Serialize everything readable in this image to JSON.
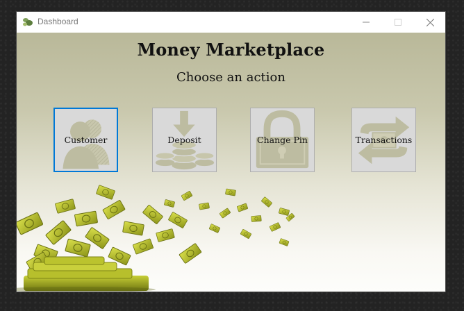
{
  "window": {
    "title": "Dashboard",
    "controls": {
      "minimize": "—",
      "maximize": "☐",
      "close": "✕"
    }
  },
  "main": {
    "heading": "Money Marketplace",
    "subheading": "Choose an action",
    "actions": [
      {
        "label": "Customer",
        "icon": "customer-icon"
      },
      {
        "label": "Deposit",
        "icon": "deposit-icon"
      },
      {
        "label": "Change Pin",
        "icon": "lock-icon"
      },
      {
        "label": "Transactions",
        "icon": "transactions-icon"
      }
    ]
  },
  "colors": {
    "focus_border": "#0078d7",
    "button_bg": "#d9d9d9",
    "icon_tint": "#bdbca1",
    "money_green": "#b9c22a"
  }
}
